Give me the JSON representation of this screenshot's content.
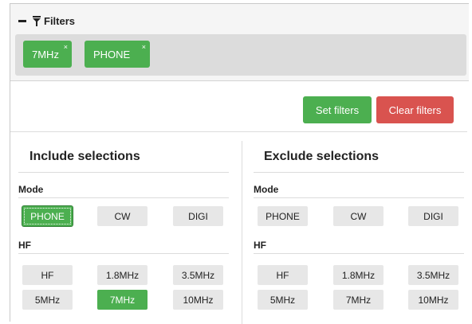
{
  "filters": {
    "title": "Filters",
    "chips": [
      {
        "label": "7MHz",
        "remove": "×"
      },
      {
        "label": "PHONE",
        "remove": "×"
      }
    ]
  },
  "actions": {
    "set_label": "Set filters",
    "clear_label": "Clear filters"
  },
  "include": {
    "title": "Include selections",
    "mode_label": "Mode",
    "mode": [
      "PHONE",
      "CW",
      "DIGI"
    ],
    "hf_label": "HF",
    "hf_row1": [
      "HF",
      "1.8MHz",
      "3.5MHz"
    ],
    "hf_row2": [
      "5MHz",
      "7MHz",
      "10MHz"
    ],
    "selected": [
      "PHONE",
      "7MHz"
    ]
  },
  "exclude": {
    "title": "Exclude selections",
    "mode_label": "Mode",
    "mode": [
      "PHONE",
      "CW",
      "DIGI"
    ],
    "hf_label": "HF",
    "hf_row1": [
      "HF",
      "1.8MHz",
      "3.5MHz"
    ],
    "hf_row2": [
      "5MHz",
      "7MHz",
      "10MHz"
    ]
  },
  "colors": {
    "accent_green": "#4caf50",
    "danger_red": "#d9534f"
  },
  "icons": {
    "collapse": "minus-icon",
    "filter": "funnel-icon"
  }
}
